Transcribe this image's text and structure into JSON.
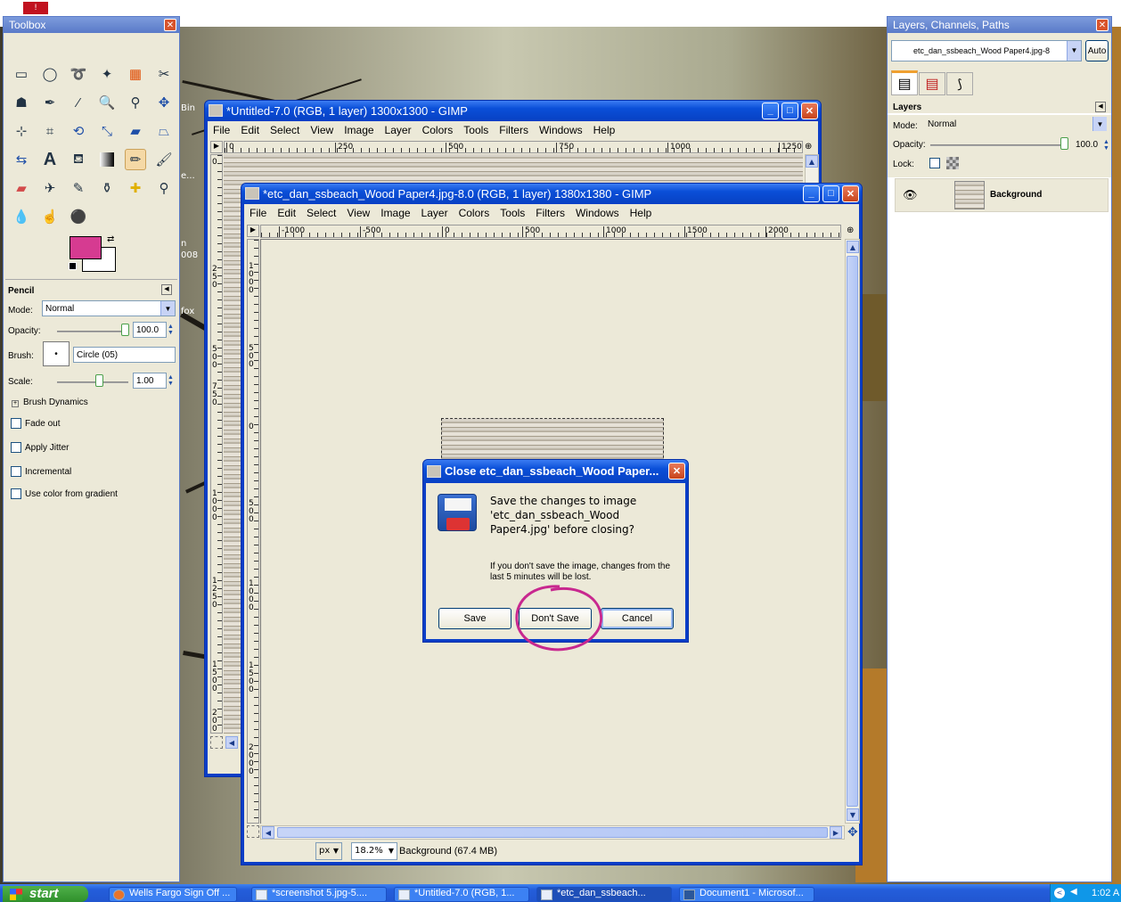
{
  "toolbox": {
    "title": "Toolbox",
    "tool_options_title": "Pencil",
    "mode_label": "Mode:",
    "mode_value": "Normal",
    "opacity_label": "Opacity:",
    "opacity_value": "100.0",
    "brush_label": "Brush:",
    "brush_value": "Circle (05)",
    "scale_label": "Scale:",
    "scale_value": "1.00",
    "brush_dynamics": "Brush Dynamics",
    "options": [
      "Fade out",
      "Apply Jitter",
      "Incremental",
      "Use color from gradient"
    ],
    "fg_color": "#d63b91",
    "bg_color": "#ffffff"
  },
  "dock": {
    "title": "Layers, Channels, Paths",
    "image_select": "etc_dan_ssbeach_Wood Paper4.jpg-8",
    "auto_button": "Auto",
    "layers_title": "Layers",
    "mode_label": "Mode:",
    "mode_value": "Normal",
    "opacity_label": "Opacity:",
    "opacity_value": "100.0",
    "lock_label": "Lock:",
    "layer_name": "Background"
  },
  "desktop_fragments": [
    "Bin",
    "e...",
    "n",
    "008",
    "fox"
  ],
  "window1": {
    "title": "*Untitled-7.0 (RGB, 1 layer) 1300x1300 - GIMP",
    "ruler_labels": [
      "0",
      "250",
      "500",
      "750",
      "1000",
      "1250"
    ],
    "vruler_labels": [
      "0",
      "250",
      "500",
      "750",
      "1000",
      "1250",
      "1500",
      "2000"
    ]
  },
  "menus": [
    "File",
    "Edit",
    "Select",
    "View",
    "Image",
    "Layer",
    "Colors",
    "Tools",
    "Filters",
    "Windows",
    "Help"
  ],
  "window2": {
    "title": "*etc_dan_ssbeach_Wood Paper4.jpg-8.0 (RGB, 1 layer) 1380x1380 - GIMP",
    "ruler_labels": [
      "-1000",
      "-500",
      "0",
      "500",
      "1000",
      "1500",
      "2000"
    ],
    "vruler_labels": [
      "1000",
      "500",
      "0",
      "500",
      "1000",
      "1500",
      "2000"
    ],
    "unit": "px",
    "zoom": "18.2%",
    "status": "Background (67.4 MB)"
  },
  "dialog": {
    "title": "Close etc_dan_ssbeach_Wood Paper...",
    "heading": "Save the changes to image 'etc_dan_ssbeach_Wood Paper4.jpg' before closing?",
    "message": "If you don't save the image, changes from the last 5 minutes will be lost.",
    "save": "Save",
    "dont_save": "Don't Save",
    "cancel": "Cancel",
    "highlight_color": "#c8288f"
  },
  "taskbar": {
    "start": "start",
    "tasks": [
      "Wells Fargo Sign Off ...",
      "*screenshot 5.jpg-5....",
      "*Untitled-7.0 (RGB, 1...",
      "*etc_dan_ssbeach...",
      "Document1 - Microsof..."
    ],
    "clock": "1:02 A"
  }
}
